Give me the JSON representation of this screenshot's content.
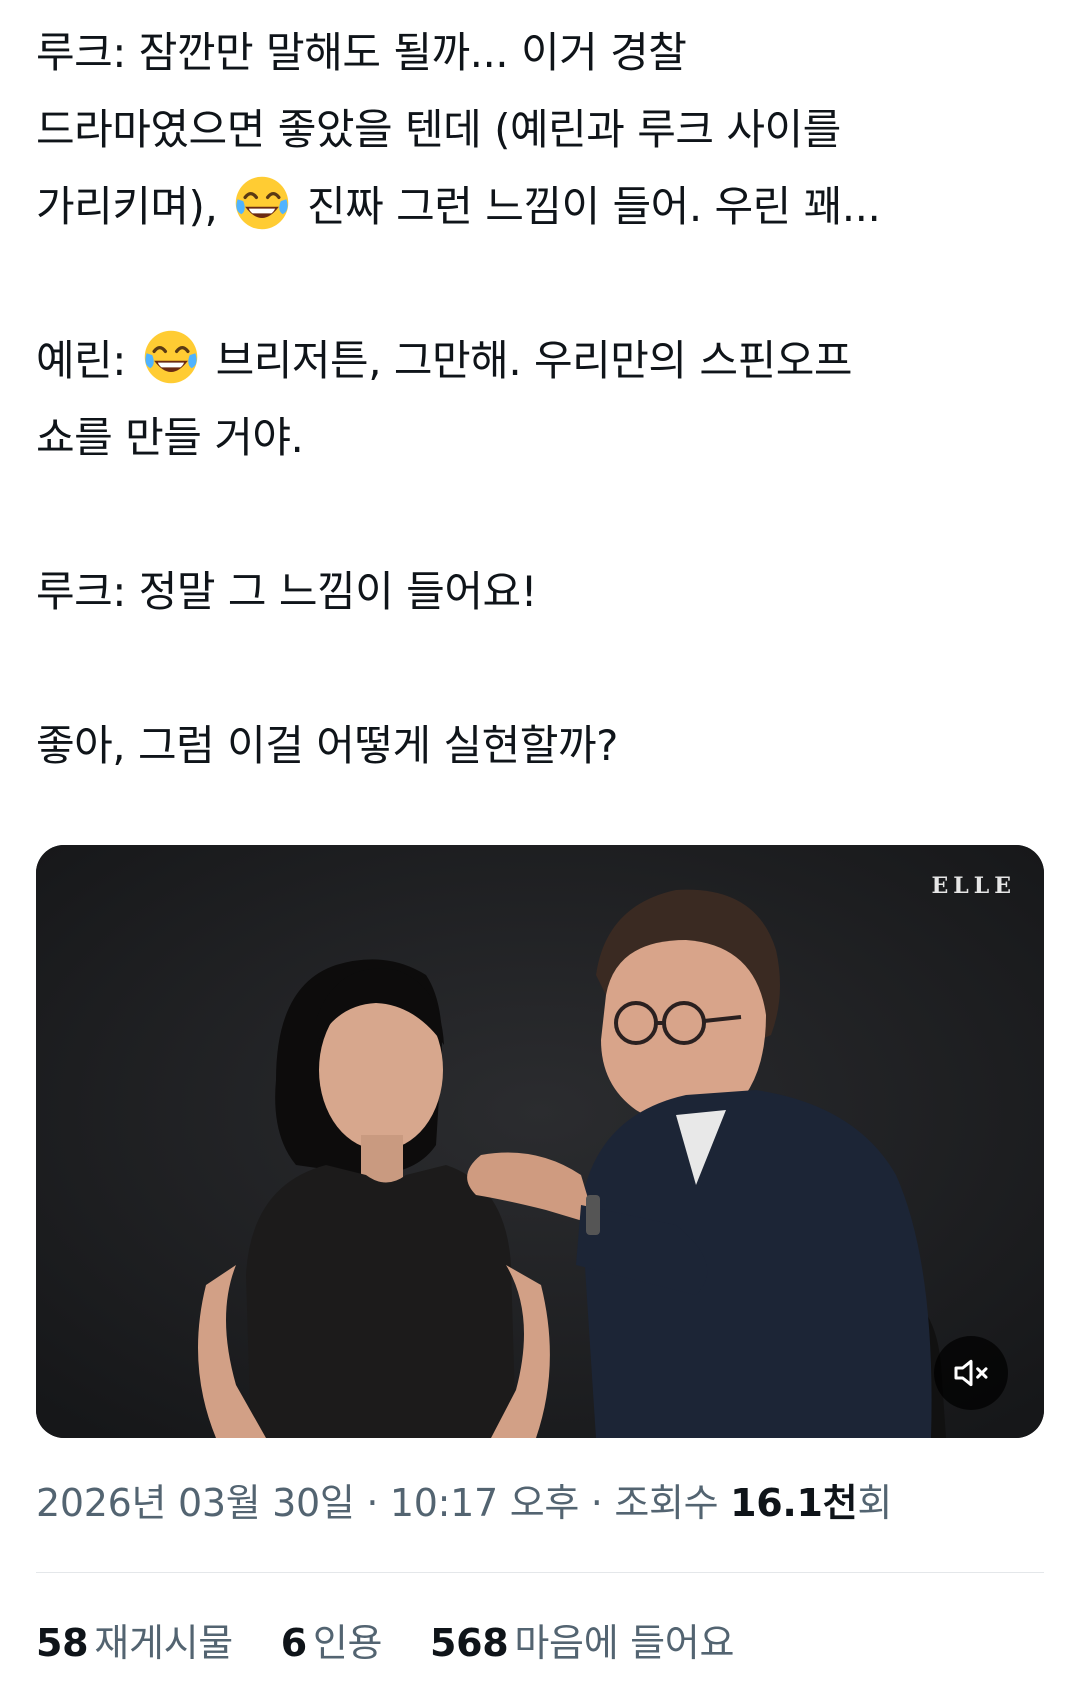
{
  "tweet": {
    "paragraphs": [
      {
        "lines": [
          [
            "루크: 잠깐만 말해도 될까... 이거 경찰"
          ],
          [
            "드라마였으면 좋았을 텐데 (예린과 루크 사이를"
          ],
          [
            "가리키며), ",
            {
              "emoji": "face-with-tears-of-joy"
            },
            " 진짜 그런 느낌이 들어. 우린 꽤..."
          ]
        ]
      },
      {
        "lines": [
          [
            "예린: ",
            {
              "emoji": "face-with-tears-of-joy"
            },
            " 브리저튼, 그만해. 우리만의 스핀오프"
          ],
          [
            "쇼를 만들 거야."
          ]
        ]
      },
      {
        "lines": [
          [
            "루크: 정말 그 느낌이 들어요!"
          ]
        ]
      },
      {
        "lines": [
          [
            "좋아, 그럼 이걸 어떻게 실현할까?"
          ]
        ]
      }
    ]
  },
  "media": {
    "watermark": "ELLE",
    "mute_icon": "volume-muted-icon"
  },
  "meta": {
    "date": "2026년 03월 30일",
    "sep1": " · ",
    "time": "10:17 오후",
    "sep2": " · ",
    "views_label": "조회수 ",
    "views_count": "16.1천",
    "views_suffix": "회"
  },
  "stats": {
    "reposts_count": "58",
    "reposts_label": "재게시물",
    "quotes_count": "6",
    "quotes_label": "인용",
    "likes_count": "568",
    "likes_label": "마음에 들어요"
  },
  "colors": {
    "text": "#0f1419",
    "secondary": "#536471",
    "divider": "#e4e7ea"
  }
}
